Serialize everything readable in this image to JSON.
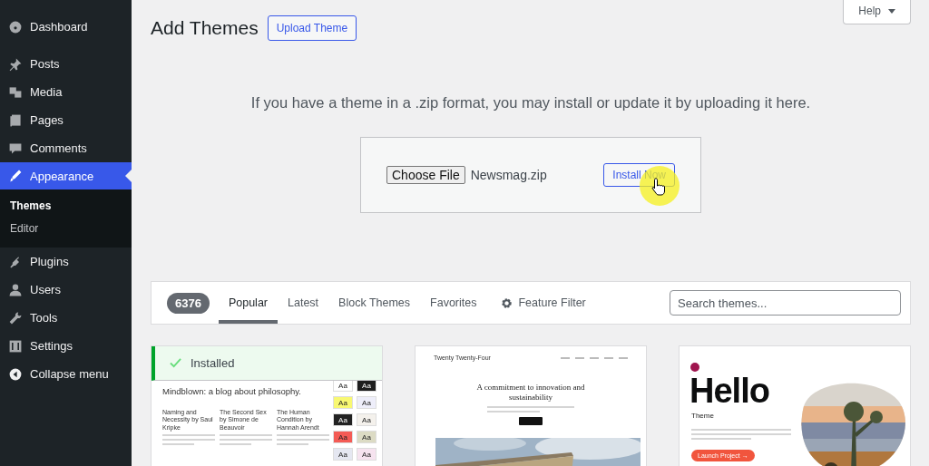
{
  "sidebar": {
    "items": [
      {
        "label": "Dashboard",
        "selected": false
      },
      {
        "label": "Posts",
        "selected": false
      },
      {
        "label": "Media",
        "selected": false
      },
      {
        "label": "Pages",
        "selected": false
      },
      {
        "label": "Comments",
        "selected": false
      },
      {
        "label": "Appearance",
        "selected": true,
        "children": [
          {
            "label": "Themes",
            "selected": true
          },
          {
            "label": "Editor",
            "selected": false
          }
        ]
      },
      {
        "label": "Plugins",
        "selected": false
      },
      {
        "label": "Users",
        "selected": false
      },
      {
        "label": "Tools",
        "selected": false
      },
      {
        "label": "Settings",
        "selected": false
      }
    ],
    "collapse": "Collapse menu"
  },
  "header": {
    "title": "Add Themes",
    "upload_button": "Upload Theme",
    "help_button": "Help"
  },
  "upload": {
    "intro": "If you have a theme in a .zip format, you may install or update it by uploading it here.",
    "file_button": "Choose File",
    "file_name": "Newsmag.zip",
    "install_button": "Install Now"
  },
  "filter_bar": {
    "count": "6376",
    "tabs": [
      {
        "label": "Popular",
        "selected": true
      },
      {
        "label": "Latest",
        "selected": false
      },
      {
        "label": "Block Themes",
        "selected": false
      },
      {
        "label": "Favorites",
        "selected": false
      }
    ],
    "feature_filter": "Feature Filter",
    "search": {
      "placeholder": "Search themes..."
    }
  },
  "themes": [
    {
      "kind": "blog",
      "installed": true,
      "installed_label": "Installed",
      "headline": "Mindblown: a blog about philosophy.",
      "books": [
        "Naming and Necessity by Saul Kripke",
        "The Second Sex by Simone de Beauvoir",
        "The Human Condition by Hannah Arendt"
      ],
      "swatches": [
        {
          "label": "Aa",
          "color": "#ffffff"
        },
        {
          "label": "Aa",
          "color": "#1e1e1e"
        },
        {
          "label": "Aa",
          "color": "#f8f872"
        },
        {
          "label": "Aa",
          "color": "#eeeefa"
        },
        {
          "label": "Aa",
          "color": "#222222"
        },
        {
          "label": "Aa",
          "color": "#f4f1ec"
        },
        {
          "label": "Aa",
          "color": "#f45b55"
        },
        {
          "label": "Aa",
          "color": "#dcdbc4"
        },
        {
          "label": "Aa",
          "color": "#e5e7f1"
        },
        {
          "label": "Aa",
          "color": "#f6e3ef"
        }
      ]
    },
    {
      "kind": "business",
      "installed": false,
      "site_title": "Twenty Twenty-Four",
      "headline": "A commitment to innovation and sustainability"
    },
    {
      "kind": "landing",
      "installed": false,
      "headline": "Hello",
      "subtitle": "Theme",
      "button_label": "Launch Project →"
    }
  ]
}
